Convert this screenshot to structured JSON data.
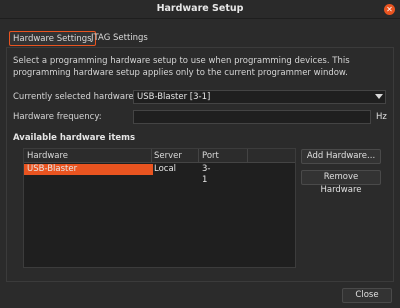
{
  "window": {
    "title": "Hardware Setup"
  },
  "tabs": [
    {
      "label": "Hardware Settings",
      "active": true
    },
    {
      "label": "JTAG Settings",
      "active": false
    }
  ],
  "description": "Select a programming hardware setup to use when programming devices. This programming hardware setup applies only to the current programmer window.",
  "fields": {
    "current_hardware_label": "Currently selected hardware:",
    "current_hardware_value": "USB-Blaster [3-1]",
    "frequency_label": "Hardware frequency:",
    "frequency_value": "",
    "frequency_unit": "Hz"
  },
  "available": {
    "title": "Available hardware items",
    "columns": [
      "Hardware",
      "Server",
      "Port"
    ],
    "rows": [
      {
        "hardware": "USB-Blaster",
        "server": "Local",
        "port": "3-1",
        "selected": true
      }
    ]
  },
  "buttons": {
    "add": "Add Hardware...",
    "remove": "Remove Hardware",
    "close": "Close"
  },
  "colors": {
    "accent": "#e95420",
    "background": "#2b2b2b"
  },
  "icons": {
    "close": "close-icon",
    "dropdown": "chevron-down-icon"
  }
}
